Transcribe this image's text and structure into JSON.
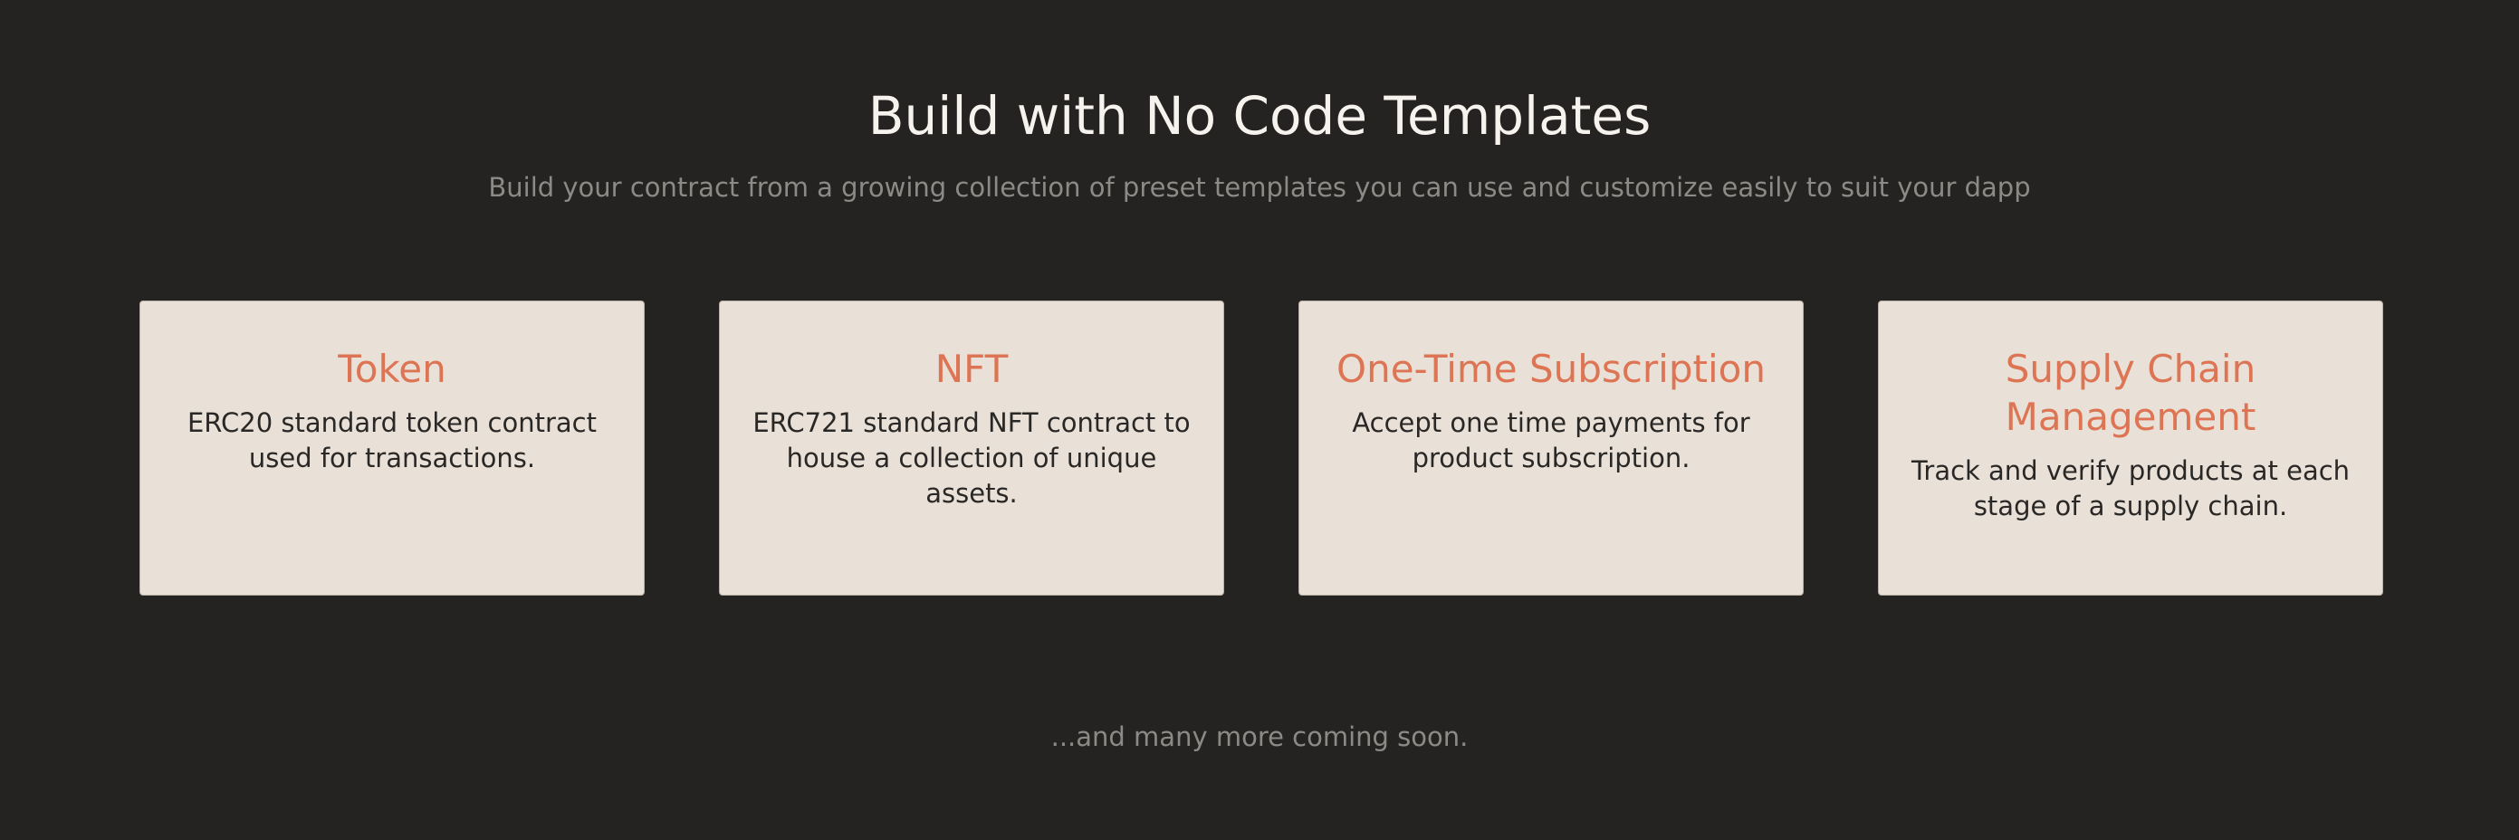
{
  "header": {
    "title": "Build with No Code Templates",
    "subtitle": "Build your contract from a growing collection of preset templates you can use and customize easily to suit your dapp"
  },
  "cards": [
    {
      "title": "Token",
      "description": "ERC20 standard token contract used for transactions."
    },
    {
      "title": "NFT",
      "description": "ERC721 standard NFT contract to house a collection of unique assets."
    },
    {
      "title": "One-Time Subscription",
      "description": "Accept one time payments for product subscription."
    },
    {
      "title": "Supply Chain Management",
      "description": "Track and verify products at each stage of a supply chain."
    }
  ],
  "footer": {
    "note": "...and many more coming soon."
  },
  "colors": {
    "background": "#252321",
    "card_background": "#e9e1d7",
    "accent": "#dd7555",
    "title_text": "#f6f2ee",
    "muted_text": "#8c8a87",
    "body_text": "#2a2826"
  }
}
